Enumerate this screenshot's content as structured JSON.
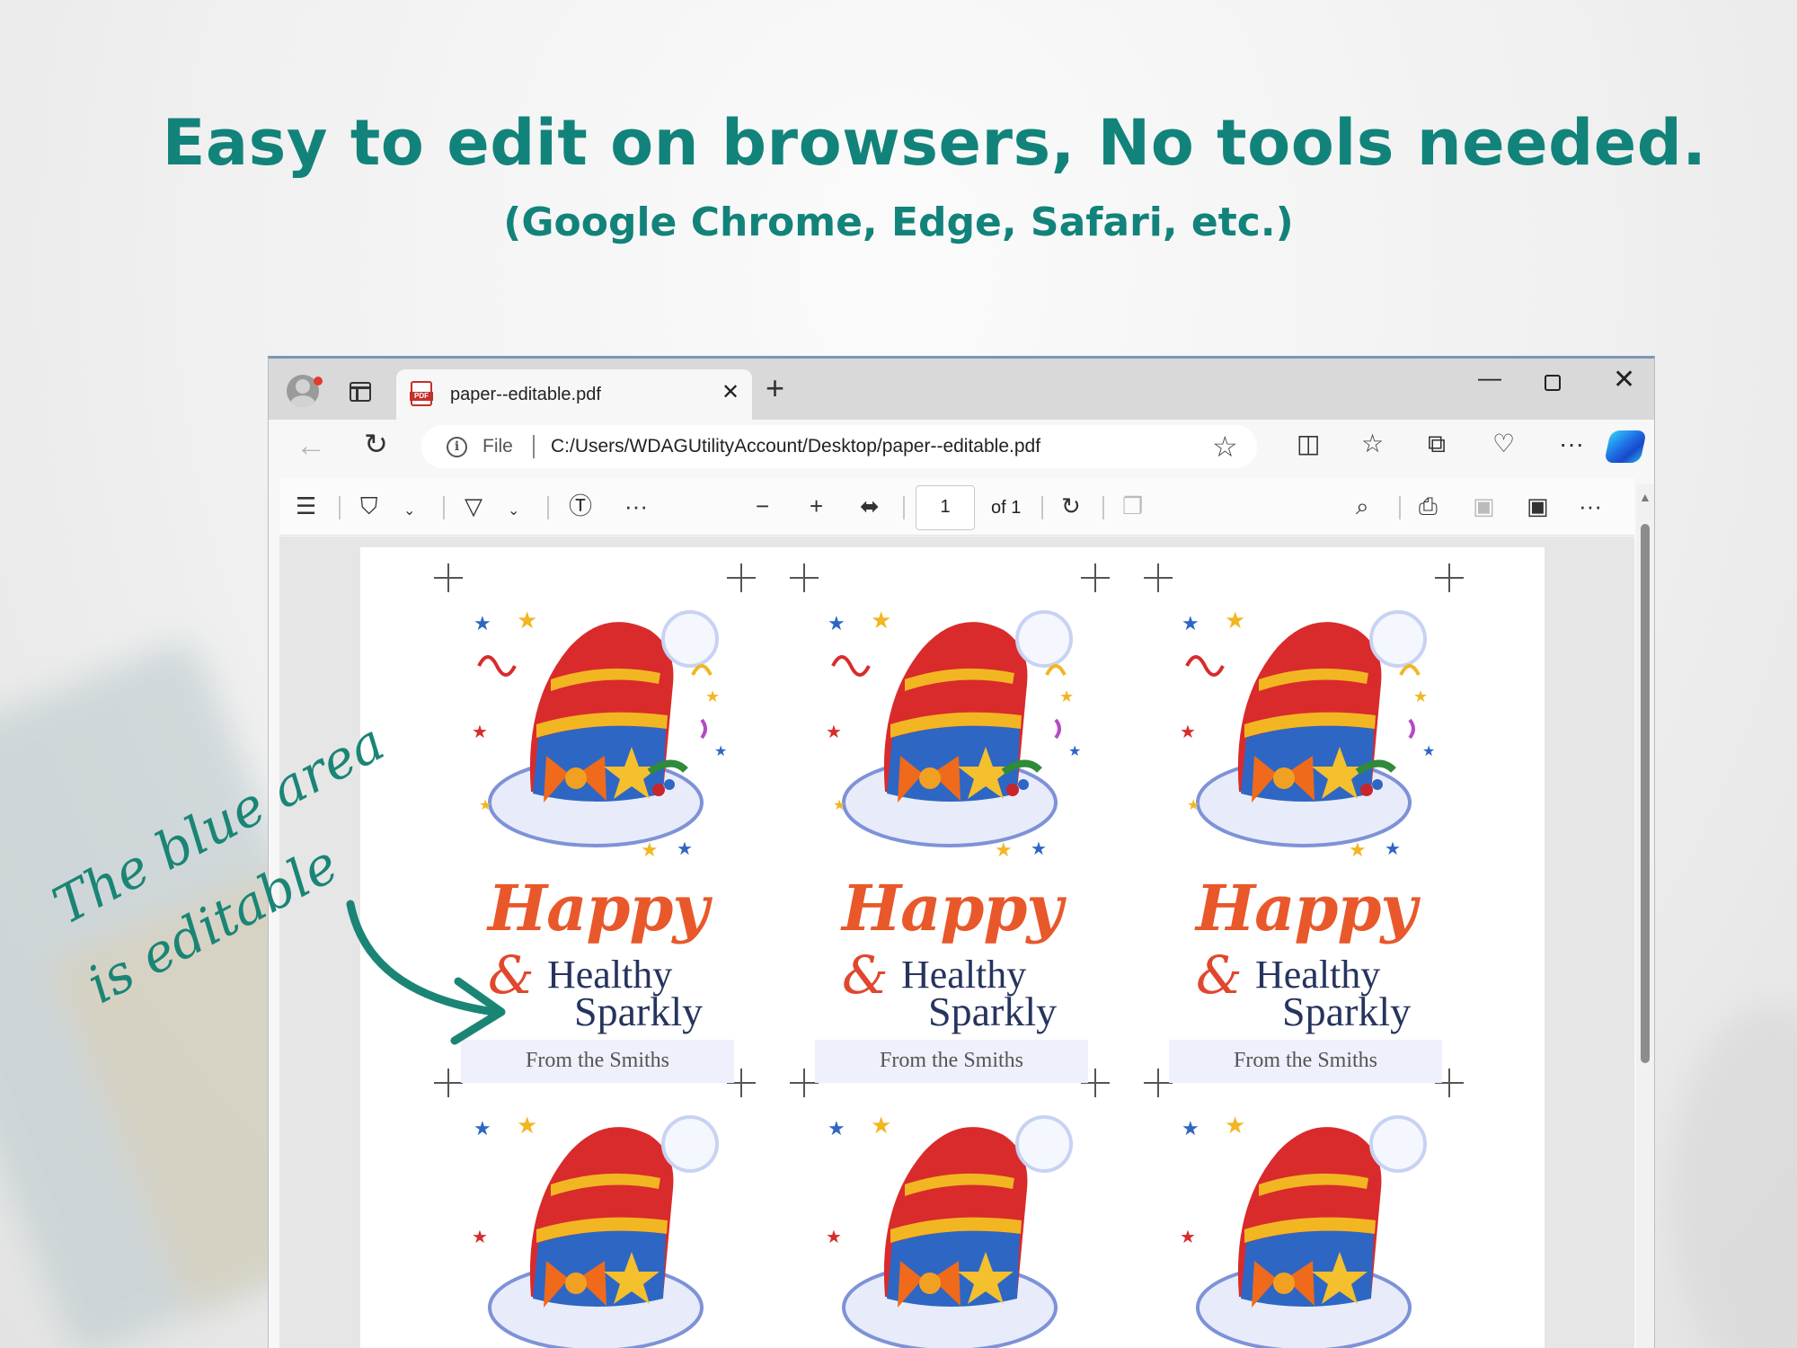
{
  "headline": "Easy to edit on browsers, No tools needed.",
  "subheadline": "(Google Chrome, Edge, Safari, etc.)",
  "annotation": {
    "line1": "The blue area",
    "line2": "is editable"
  },
  "browser": {
    "tab_title": "paper--editable.pdf",
    "tab_close": "✕",
    "new_tab": "+",
    "address": {
      "scheme_label": "File",
      "url": "C:/Users/WDAGUtilityAccount/Desktop/paper--editable.pdf"
    },
    "pdf_toolbar": {
      "page_number": "1",
      "page_total": "of 1"
    },
    "window_controls": {
      "minimize": "—",
      "close": "✕"
    }
  },
  "cards": [
    {
      "happy": "Happy",
      "amp": "&",
      "healthy": "Healthy",
      "sparkly": "Sparkly",
      "from": "From the Smiths"
    },
    {
      "happy": "Happy",
      "amp": "&",
      "healthy": "Healthy",
      "sparkly": "Sparkly",
      "from": "From the Smiths"
    },
    {
      "happy": "Happy",
      "amp": "&",
      "healthy": "Healthy",
      "sparkly": "Sparkly",
      "from": "From the Smiths"
    }
  ],
  "colors": {
    "accent": "#12837a",
    "happy_text": "#e8582b",
    "name_text": "#26345e",
    "editable_area": "#eef0fb"
  }
}
